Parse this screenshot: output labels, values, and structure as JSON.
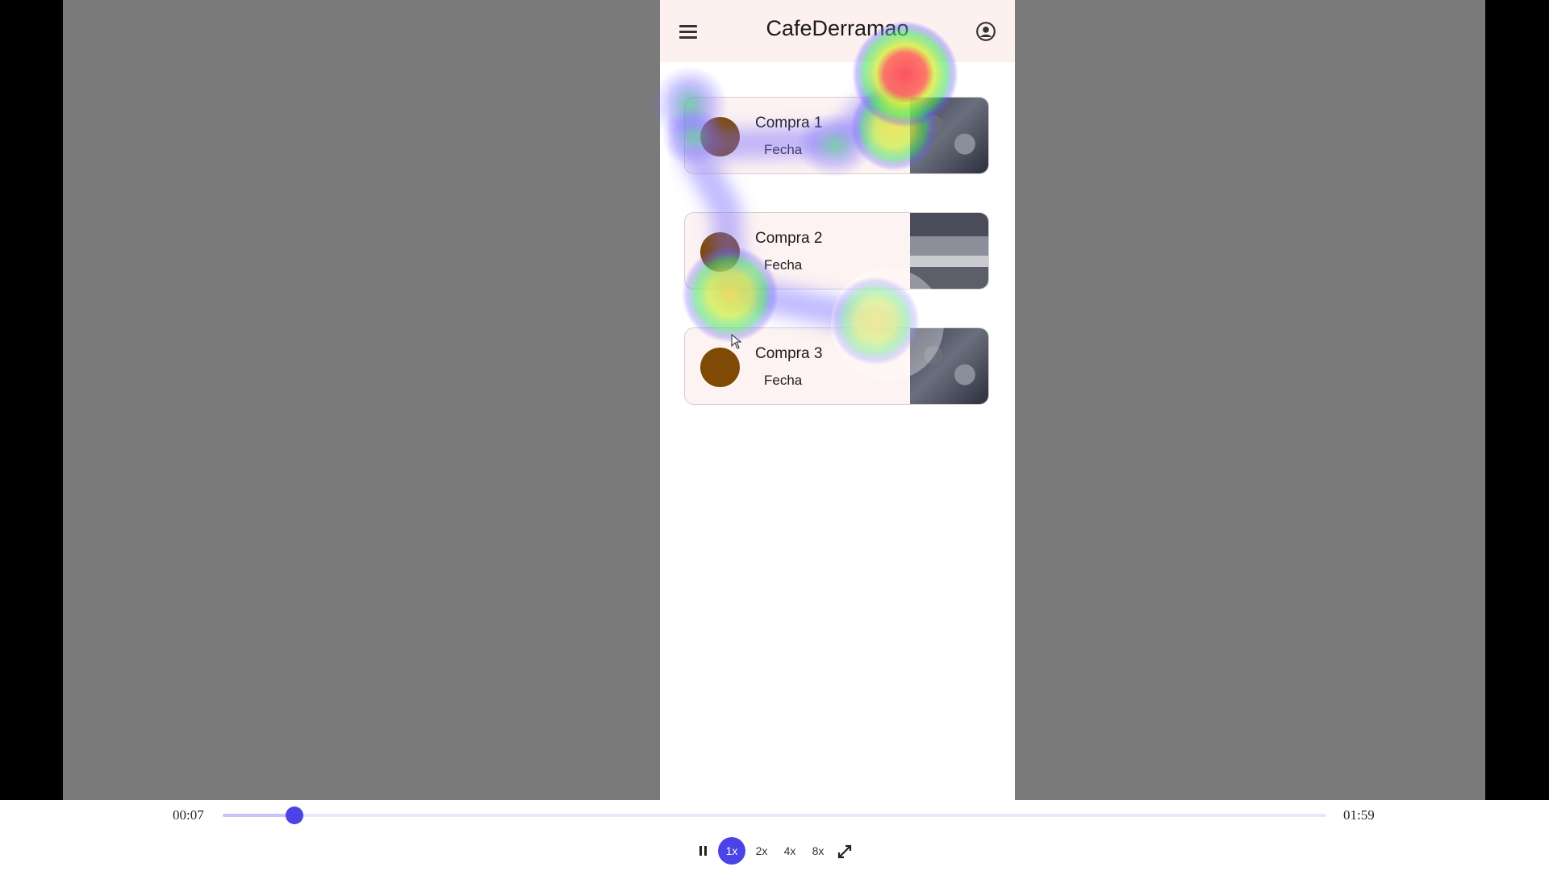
{
  "app": {
    "title": "CafeDerramao",
    "menu_icon": "hamburger-menu-icon",
    "account_icon": "account-circle-icon"
  },
  "purchases": [
    {
      "title": "Compra 1",
      "date": "Fecha"
    },
    {
      "title": "Compra 2",
      "date": "Fecha"
    },
    {
      "title": "Compra 3",
      "date": "Fecha"
    }
  ],
  "player": {
    "current_time": "00:07",
    "total_time": "01:59",
    "progress": 0.065,
    "speeds": [
      "1x",
      "2x",
      "4x",
      "8x"
    ],
    "active_speed": "1x",
    "pause_icon": "pause-icon",
    "fullscreen_icon": "fullscreen-icon"
  },
  "colors": {
    "accent": "#4a43e6",
    "appbar_bg": "#fdf1f0",
    "avatar": "#7e4a05"
  }
}
